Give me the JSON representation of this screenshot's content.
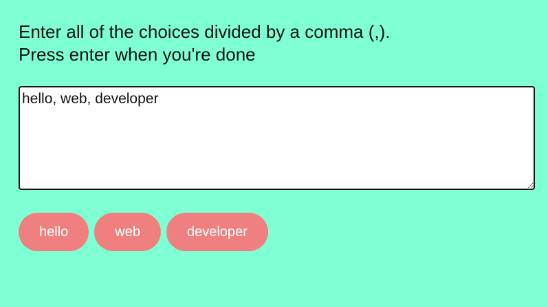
{
  "instructions": {
    "line1": "Enter all of the choices divided by a comma (,).",
    "line2": "Press enter when you're done"
  },
  "choices_input": {
    "value": "hello, web, developer"
  },
  "tags": [
    {
      "label": "hello"
    },
    {
      "label": "web"
    },
    {
      "label": "developer"
    }
  ],
  "colors": {
    "background": "#7fffd4",
    "tag_background": "#f08080",
    "tag_text": "#ffffff"
  }
}
